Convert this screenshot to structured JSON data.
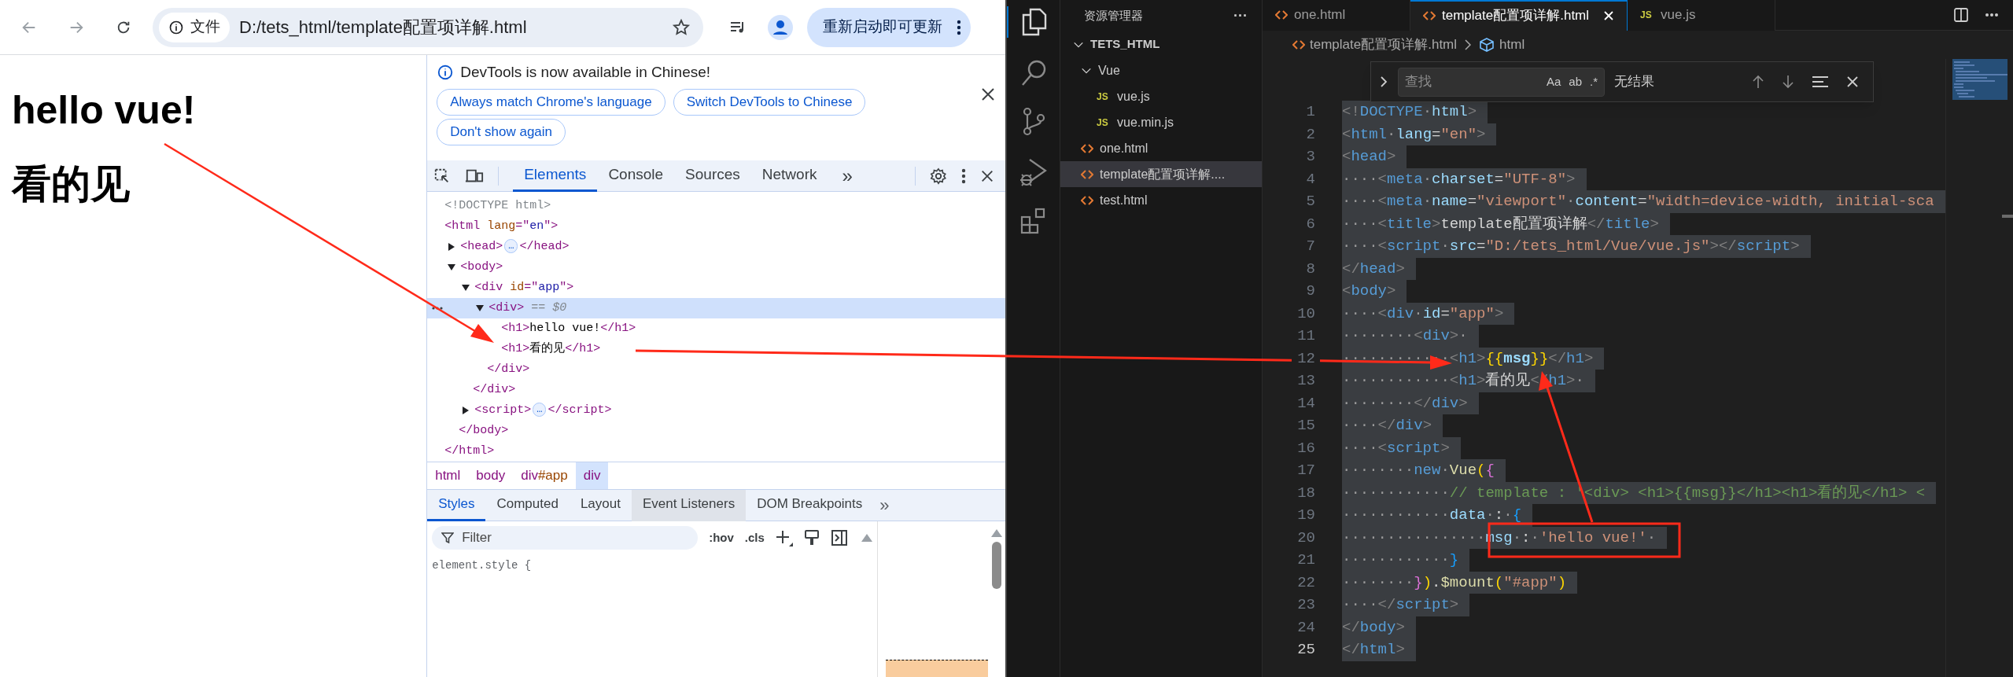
{
  "browser": {
    "url_chip": "文件",
    "url": "D:/tets_html/template配置项详解.html",
    "update_button": "重新启动即可更新"
  },
  "page": {
    "headings": [
      "hello vue!",
      "看的见"
    ]
  },
  "devtools": {
    "infobar": {
      "message": "DevTools is now available in Chinese!",
      "buttons": [
        "Always match Chrome's language",
        "Switch DevTools to Chinese",
        "Don't show again"
      ]
    },
    "tabs": [
      {
        "label": "Elements",
        "selected": true
      },
      {
        "label": "Console",
        "selected": false
      },
      {
        "label": "Sources",
        "selected": false
      },
      {
        "label": "Network",
        "selected": false
      }
    ],
    "more_tabs": "»",
    "dom": [
      {
        "tokens": [
          {
            "kind": "doctype",
            "text": "<!DOCTYPE html>"
          }
        ],
        "selected": false
      },
      {
        "tokens": [
          {
            "kind": "tag",
            "text": "<html "
          },
          {
            "kind": "attr",
            "text": "lang"
          },
          {
            "kind": "tag",
            "text": "=\""
          },
          {
            "kind": "val",
            "text": "en"
          },
          {
            "kind": "tag",
            "text": "\">"
          }
        ],
        "selected": false,
        "children": [
          {
            "tokens": [
              {
                "kind": "tag",
                "text": "<head>"
              },
              {
                "kind": "more",
                "text": "…"
              },
              {
                "kind": "tag",
                "text": "</head>"
              }
            ],
            "expanded": false,
            "selected": false
          },
          {
            "tokens": [
              {
                "kind": "tag",
                "text": "<body>"
              }
            ],
            "expanded": true,
            "selected": false,
            "children": [
              {
                "tokens": [
                  {
                    "kind": "tag",
                    "text": "<div "
                  },
                  {
                    "kind": "attr",
                    "text": "id"
                  },
                  {
                    "kind": "tag",
                    "text": "=\""
                  },
                  {
                    "kind": "val",
                    "text": "app"
                  },
                  {
                    "kind": "tag",
                    "text": "\">"
                  }
                ],
                "expanded": true,
                "selected": false,
                "children": [
                  {
                    "tokens": [
                      {
                        "kind": "tag",
                        "text": "<div>"
                      },
                      {
                        "kind": "dim",
                        "text": " == $0"
                      }
                    ],
                    "expanded": true,
                    "selected": true,
                    "children": [
                      {
                        "tokens": [
                          {
                            "kind": "tag",
                            "text": "<h1>"
                          },
                          {
                            "kind": "text",
                            "text": "hello vue!"
                          },
                          {
                            "kind": "tag",
                            "text": "</h1>"
                          }
                        ],
                        "selected": false
                      },
                      {
                        "tokens": [
                          {
                            "kind": "tag",
                            "text": "<h1>"
                          },
                          {
                            "kind": "text",
                            "text": "看的见"
                          },
                          {
                            "kind": "tag",
                            "text": "</h1>"
                          }
                        ],
                        "selected": false
                      }
                    ],
                    "end": "</div>"
                  }
                ],
                "end": "</div>"
              },
              {
                "tokens": [
                  {
                    "kind": "tag",
                    "text": "<script>"
                  },
                  {
                    "kind": "more",
                    "text": "…"
                  },
                  {
                    "kind": "tag",
                    "text": "</script>"
                  }
                ],
                "expanded": false,
                "selected": false
              }
            ],
            "end": "</body>"
          }
        ],
        "end": "</html>"
      }
    ],
    "breadcrumbs": [
      {
        "label": "html",
        "selected": false
      },
      {
        "label": "body",
        "selected": false
      },
      {
        "label": "div",
        "id": "#app",
        "selected": false
      },
      {
        "label": "div",
        "selected": true
      }
    ],
    "style_tabs": [
      {
        "label": "Styles",
        "selected": true,
        "hovered": false
      },
      {
        "label": "Computed",
        "selected": false,
        "hovered": false
      },
      {
        "label": "Layout",
        "selected": false,
        "hovered": false
      },
      {
        "label": "Event Listeners",
        "selected": false,
        "hovered": true
      },
      {
        "label": "DOM Breakpoints",
        "selected": false,
        "hovered": false
      }
    ],
    "style_more": "»",
    "filter": {
      "placeholder": "Filter"
    },
    "filter_buttons": [
      ":hov",
      ".cls"
    ],
    "rule": "element.style {"
  },
  "explorer": {
    "title": "资源管理器",
    "more": "···",
    "tree": [
      {
        "label": "TETS_HTML",
        "kind": "root",
        "expanded": true,
        "selected": false,
        "children": [
          {
            "label": "Vue",
            "kind": "folder",
            "expanded": true,
            "selected": false,
            "children": [
              {
                "label": "vue.js",
                "kind": "js",
                "icon": "JS",
                "selected": false
              },
              {
                "label": "vue.min.js",
                "kind": "js",
                "icon": "JS",
                "selected": false
              }
            ]
          },
          {
            "label": "one.html",
            "kind": "html",
            "selected": false
          },
          {
            "label": "template配置项详解....",
            "kind": "html",
            "selected": true
          },
          {
            "label": "test.html",
            "kind": "html",
            "selected": false
          }
        ]
      }
    ]
  },
  "editor": {
    "tabs": [
      {
        "label": "one.html",
        "kind": "html",
        "selected": false
      },
      {
        "label": "template配置项详解.html",
        "kind": "html",
        "selected": true
      },
      {
        "label": "vue.js",
        "kind": "js",
        "icon": "JS",
        "selected": false
      }
    ],
    "breadcrumb": [
      "template配置项详解.html",
      "html"
    ],
    "find": {
      "placeholder": "查找",
      "options": [
        "Aa",
        "ab",
        ".*"
      ],
      "result": "无结果"
    },
    "lines": [
      {
        "number": "1",
        "current": false,
        "tokens": [
          {
            "kind": "p",
            "text": "<!"
          },
          {
            "kind": "t",
            "text": "DOCTYPE"
          },
          {
            "kind": "a",
            "text": "·html"
          },
          {
            "kind": "p",
            "text": ">"
          }
        ]
      },
      {
        "number": "2",
        "current": false,
        "tokens": [
          {
            "kind": "p",
            "text": "<"
          },
          {
            "kind": "t",
            "text": "html"
          },
          {
            "kind": "a",
            "text": "·lang"
          },
          {
            "kind": "x",
            "text": "="
          },
          {
            "kind": "s",
            "text": "\"en\""
          },
          {
            "kind": "p",
            "text": ">"
          }
        ]
      },
      {
        "number": "3",
        "current": false,
        "tokens": [
          {
            "kind": "p",
            "text": "<"
          },
          {
            "kind": "t",
            "text": "head"
          },
          {
            "kind": "p",
            "text": ">"
          }
        ]
      },
      {
        "number": "4",
        "current": false,
        "tokens": [
          {
            "kind": "p",
            "text": "····<"
          },
          {
            "kind": "t",
            "text": "meta"
          },
          {
            "kind": "a",
            "text": "·charset"
          },
          {
            "kind": "x",
            "text": "="
          },
          {
            "kind": "s",
            "text": "\"UTF-8\""
          },
          {
            "kind": "p",
            "text": ">"
          }
        ]
      },
      {
        "number": "5",
        "current": false,
        "tokens": [
          {
            "kind": "p",
            "text": "····<"
          },
          {
            "kind": "t",
            "text": "meta"
          },
          {
            "kind": "a",
            "text": "·name"
          },
          {
            "kind": "x",
            "text": "="
          },
          {
            "kind": "s",
            "text": "\"viewport\""
          },
          {
            "kind": "a",
            "text": "·content"
          },
          {
            "kind": "x",
            "text": "="
          },
          {
            "kind": "s",
            "text": "\"width=device-width, initial-sca"
          }
        ]
      },
      {
        "number": "6",
        "current": false,
        "tokens": [
          {
            "kind": "p",
            "text": "····<"
          },
          {
            "kind": "t",
            "text": "title"
          },
          {
            "kind": "p",
            "text": ">"
          },
          {
            "kind": "x",
            "text": "template配置项详解"
          },
          {
            "kind": "p",
            "text": "</"
          },
          {
            "kind": "t",
            "text": "title"
          },
          {
            "kind": "p",
            "text": ">"
          }
        ]
      },
      {
        "number": "7",
        "current": false,
        "tokens": [
          {
            "kind": "p",
            "text": "····<"
          },
          {
            "kind": "t",
            "text": "script"
          },
          {
            "kind": "a",
            "text": "·src"
          },
          {
            "kind": "x",
            "text": "="
          },
          {
            "kind": "s",
            "text": "\"D:/tets_html/Vue/vue.js\""
          },
          {
            "kind": "p",
            "text": "></"
          },
          {
            "kind": "t",
            "text": "script"
          },
          {
            "kind": "p",
            "text": ">"
          }
        ]
      },
      {
        "number": "8",
        "current": false,
        "tokens": [
          {
            "kind": "p",
            "text": "</"
          },
          {
            "kind": "t",
            "text": "head"
          },
          {
            "kind": "p",
            "text": ">"
          }
        ]
      },
      {
        "number": "9",
        "current": false,
        "tokens": [
          {
            "kind": "p",
            "text": "<"
          },
          {
            "kind": "t",
            "text": "body"
          },
          {
            "kind": "p",
            "text": ">"
          }
        ]
      },
      {
        "number": "10",
        "current": false,
        "tokens": [
          {
            "kind": "p",
            "text": "····<"
          },
          {
            "kind": "t",
            "text": "div"
          },
          {
            "kind": "a",
            "text": "·id"
          },
          {
            "kind": "x",
            "text": "="
          },
          {
            "kind": "s",
            "text": "\"app\""
          },
          {
            "kind": "p",
            "text": ">"
          }
        ]
      },
      {
        "number": "11",
        "current": false,
        "tokens": [
          {
            "kind": "p",
            "text": "········<"
          },
          {
            "kind": "t",
            "text": "div"
          },
          {
            "kind": "p",
            "text": ">·"
          }
        ]
      },
      {
        "number": "12",
        "current": false,
        "tokens": [
          {
            "kind": "p",
            "text": "············<"
          },
          {
            "kind": "t",
            "text": "h1"
          },
          {
            "kind": "p",
            "text": ">"
          },
          {
            "kind": "b",
            "text": "{{"
          },
          {
            "kind": "v",
            "text": "msg"
          },
          {
            "kind": "b",
            "text": "}}"
          },
          {
            "kind": "p",
            "text": "</"
          },
          {
            "kind": "t",
            "text": "h1"
          },
          {
            "kind": "p",
            "text": ">"
          }
        ]
      },
      {
        "number": "13",
        "current": false,
        "tokens": [
          {
            "kind": "p",
            "text": "············<"
          },
          {
            "kind": "t",
            "text": "h1"
          },
          {
            "kind": "p",
            "text": ">"
          },
          {
            "kind": "x",
            "text": "看的见"
          },
          {
            "kind": "p",
            "text": "</"
          },
          {
            "kind": "t",
            "text": "h1"
          },
          {
            "kind": "p",
            "text": ">·"
          }
        ]
      },
      {
        "number": "14",
        "current": false,
        "tokens": [
          {
            "kind": "p",
            "text": "········</"
          },
          {
            "kind": "t",
            "text": "div"
          },
          {
            "kind": "p",
            "text": ">"
          }
        ]
      },
      {
        "number": "15",
        "current": false,
        "tokens": [
          {
            "kind": "p",
            "text": "····</"
          },
          {
            "kind": "t",
            "text": "div"
          },
          {
            "kind": "p",
            "text": ">"
          }
        ]
      },
      {
        "number": "16",
        "current": false,
        "tokens": [
          {
            "kind": "p",
            "text": "····<"
          },
          {
            "kind": "t",
            "text": "script"
          },
          {
            "kind": "p",
            "text": ">"
          }
        ]
      },
      {
        "number": "17",
        "current": false,
        "tokens": [
          {
            "kind": "k",
            "text": "········new"
          },
          {
            "kind": "f",
            "text": "·Vue"
          },
          {
            "kind": "b",
            "text": "("
          },
          {
            "kind": "b2",
            "text": "{"
          }
        ]
      },
      {
        "number": "18",
        "current": false,
        "tokens": [
          {
            "kind": "c",
            "text": "············// template : '<div> <h1>{{msg}}</h1><h1>看的见</h1> <"
          }
        ]
      },
      {
        "number": "19",
        "current": false,
        "tokens": [
          {
            "kind": "a",
            "text": "············data"
          },
          {
            "kind": "x",
            "text": "·:·"
          },
          {
            "kind": "b3",
            "text": "{"
          }
        ]
      },
      {
        "number": "20",
        "current": false,
        "tokens": [
          {
            "kind": "a",
            "text": "················msg"
          },
          {
            "kind": "x",
            "text": "·:·"
          },
          {
            "kind": "s",
            "text": "'hello vue!'·"
          }
        ]
      },
      {
        "number": "21",
        "current": false,
        "tokens": [
          {
            "kind": "b3",
            "text": "············}"
          }
        ]
      },
      {
        "number": "22",
        "current": false,
        "tokens": [
          {
            "kind": "b2",
            "text": "········}"
          },
          {
            "kind": "b",
            "text": ")"
          },
          {
            "kind": "x",
            "text": "."
          },
          {
            "kind": "f",
            "text": "$mount"
          },
          {
            "kind": "b",
            "text": "("
          },
          {
            "kind": "s",
            "text": "\"#app\""
          },
          {
            "kind": "b",
            "text": ")"
          }
        ]
      },
      {
        "number": "23",
        "current": false,
        "tokens": [
          {
            "kind": "p",
            "text": "····</"
          },
          {
            "kind": "t",
            "text": "script"
          },
          {
            "kind": "p",
            "text": ">"
          }
        ]
      },
      {
        "number": "24",
        "current": false,
        "tokens": [
          {
            "kind": "p",
            "text": "</"
          },
          {
            "kind": "t",
            "text": "body"
          },
          {
            "kind": "p",
            "text": ">"
          }
        ]
      },
      {
        "number": "25",
        "current": true,
        "tokens": [
          {
            "kind": "p",
            "text": "</"
          },
          {
            "kind": "t",
            "text": "html"
          },
          {
            "kind": "p",
            "text": ">"
          }
        ]
      }
    ]
  }
}
